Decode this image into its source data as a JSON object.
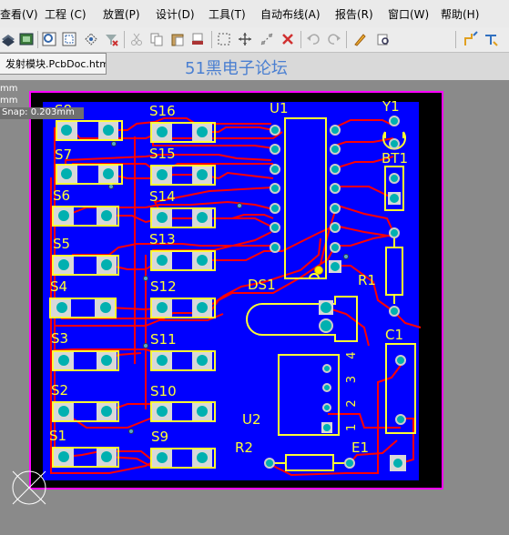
{
  "menu": {
    "items": [
      {
        "label": "查看(V)"
      },
      {
        "label": "工程 (C)"
      },
      {
        "label": "放置(P)"
      },
      {
        "label": "设计(D)"
      },
      {
        "label": "工具(T)"
      },
      {
        "label": "自动布线(A)"
      },
      {
        "label": "报告(R)"
      },
      {
        "label": "窗口(W)"
      },
      {
        "label": "帮助(H)"
      }
    ]
  },
  "toolbar": {
    "buttons": [
      {
        "icon": "layer-icon"
      },
      {
        "icon": "board-icon"
      },
      {
        "icon": "zoom-area-icon"
      },
      {
        "icon": "zoom-fit-icon"
      },
      {
        "icon": "zoom-selected-icon"
      },
      {
        "icon": "clear-filter-icon"
      },
      {
        "icon": "cut-icon"
      },
      {
        "icon": "copy-icon"
      },
      {
        "icon": "paste-icon"
      },
      {
        "icon": "rubber-stamp-icon"
      },
      {
        "icon": "select-area-icon"
      },
      {
        "icon": "move-icon"
      },
      {
        "icon": "select-connected-icon"
      },
      {
        "icon": "deselect-icon"
      },
      {
        "icon": "undo-icon"
      },
      {
        "icon": "redo-icon"
      },
      {
        "icon": "highlight-icon"
      },
      {
        "icon": "inspector-icon"
      },
      {
        "icon": "route-interactive-icon"
      },
      {
        "icon": "route-multiple-icon"
      }
    ]
  },
  "document": {
    "tab_label": "发射模块.PcbDoc.htm",
    "watermark": "51黑电子论坛"
  },
  "hud": {
    "line1": "mm",
    "line2": "mm",
    "snap": "Snap: 0.203mm"
  },
  "pcb": {
    "colors": {
      "board": "#0000ff",
      "border": "#000000",
      "outline": "#ff00ff",
      "silkscreen": "#ffff33",
      "top_trace": "#ff0000",
      "via_pad": "#00b0b0"
    },
    "designators": {
      "S8": "S8",
      "S7": "S7",
      "S6": "S6",
      "S5": "S5",
      "S4": "S4",
      "S3": "S3",
      "S2": "S2",
      "S1": "S1",
      "S16": "S16",
      "S15": "S15",
      "S14": "S14",
      "S13": "S13",
      "S12": "S12",
      "S11": "S11",
      "S10": "S10",
      "S9": "S9",
      "U1": "U1",
      "Y1": "Y1",
      "BT1": "BT1",
      "R1": "R1",
      "DS1": "DS1",
      "C1": "C1",
      "U2": "U2",
      "R2": "R2",
      "E1": "E1"
    },
    "u2_pin_numbers": "1 2 3 4"
  }
}
